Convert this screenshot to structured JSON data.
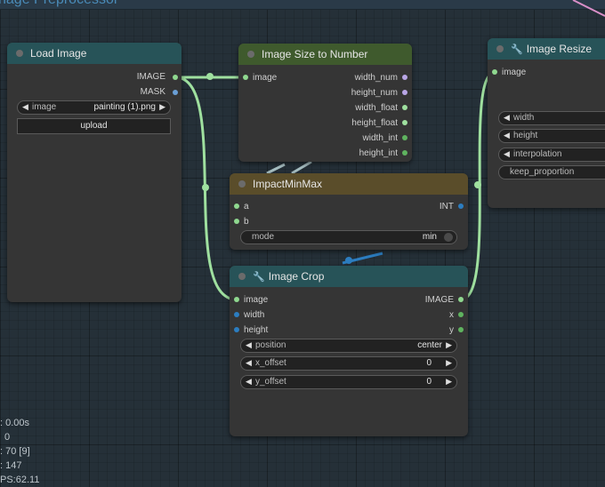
{
  "header": {
    "title_fragment": "nage Preprocessor"
  },
  "colors": {
    "wire_image": "#9fe09f",
    "wire_int": "#2c7dc0",
    "slot_image": "#8fd88f",
    "slot_mask": "#6a9fd6",
    "slot_int": "#2c7dc0",
    "slot_float": "#9fe09f",
    "slot_number": "#b9a6e6"
  },
  "load_image": {
    "title": "Load Image",
    "outputs": {
      "image": "IMAGE",
      "mask": "MASK"
    },
    "image_widget": {
      "label": "image",
      "value": "painting (1).png"
    },
    "upload_label": "upload"
  },
  "image_size_to_number": {
    "title": "Image Size to Number",
    "input_label": "image",
    "outputs": [
      "width_num",
      "height_num",
      "width_float",
      "height_float",
      "width_int",
      "height_int"
    ]
  },
  "image_resize": {
    "title": "Image Resize",
    "input_label": "image",
    "widgets": [
      "width",
      "height",
      "interpolation",
      "keep_proportion"
    ]
  },
  "impact_min_max": {
    "title": "ImpactMinMax",
    "inputs": [
      "a",
      "b"
    ],
    "output_label": "INT",
    "mode_widget": {
      "label": "mode",
      "value": "min"
    }
  },
  "image_crop": {
    "title": "Image Crop",
    "inputs": [
      "image",
      "width",
      "height"
    ],
    "outputs": [
      "IMAGE",
      "x",
      "y"
    ],
    "widgets": [
      {
        "label": "position",
        "value": "center"
      },
      {
        "label": "x_offset",
        "value": "0"
      },
      {
        "label": "y_offset",
        "value": "0"
      }
    ]
  },
  "stats": [
    ": 0.00s",
    "0",
    ": 70 [9]",
    ": 147",
    "PS:62.11"
  ]
}
